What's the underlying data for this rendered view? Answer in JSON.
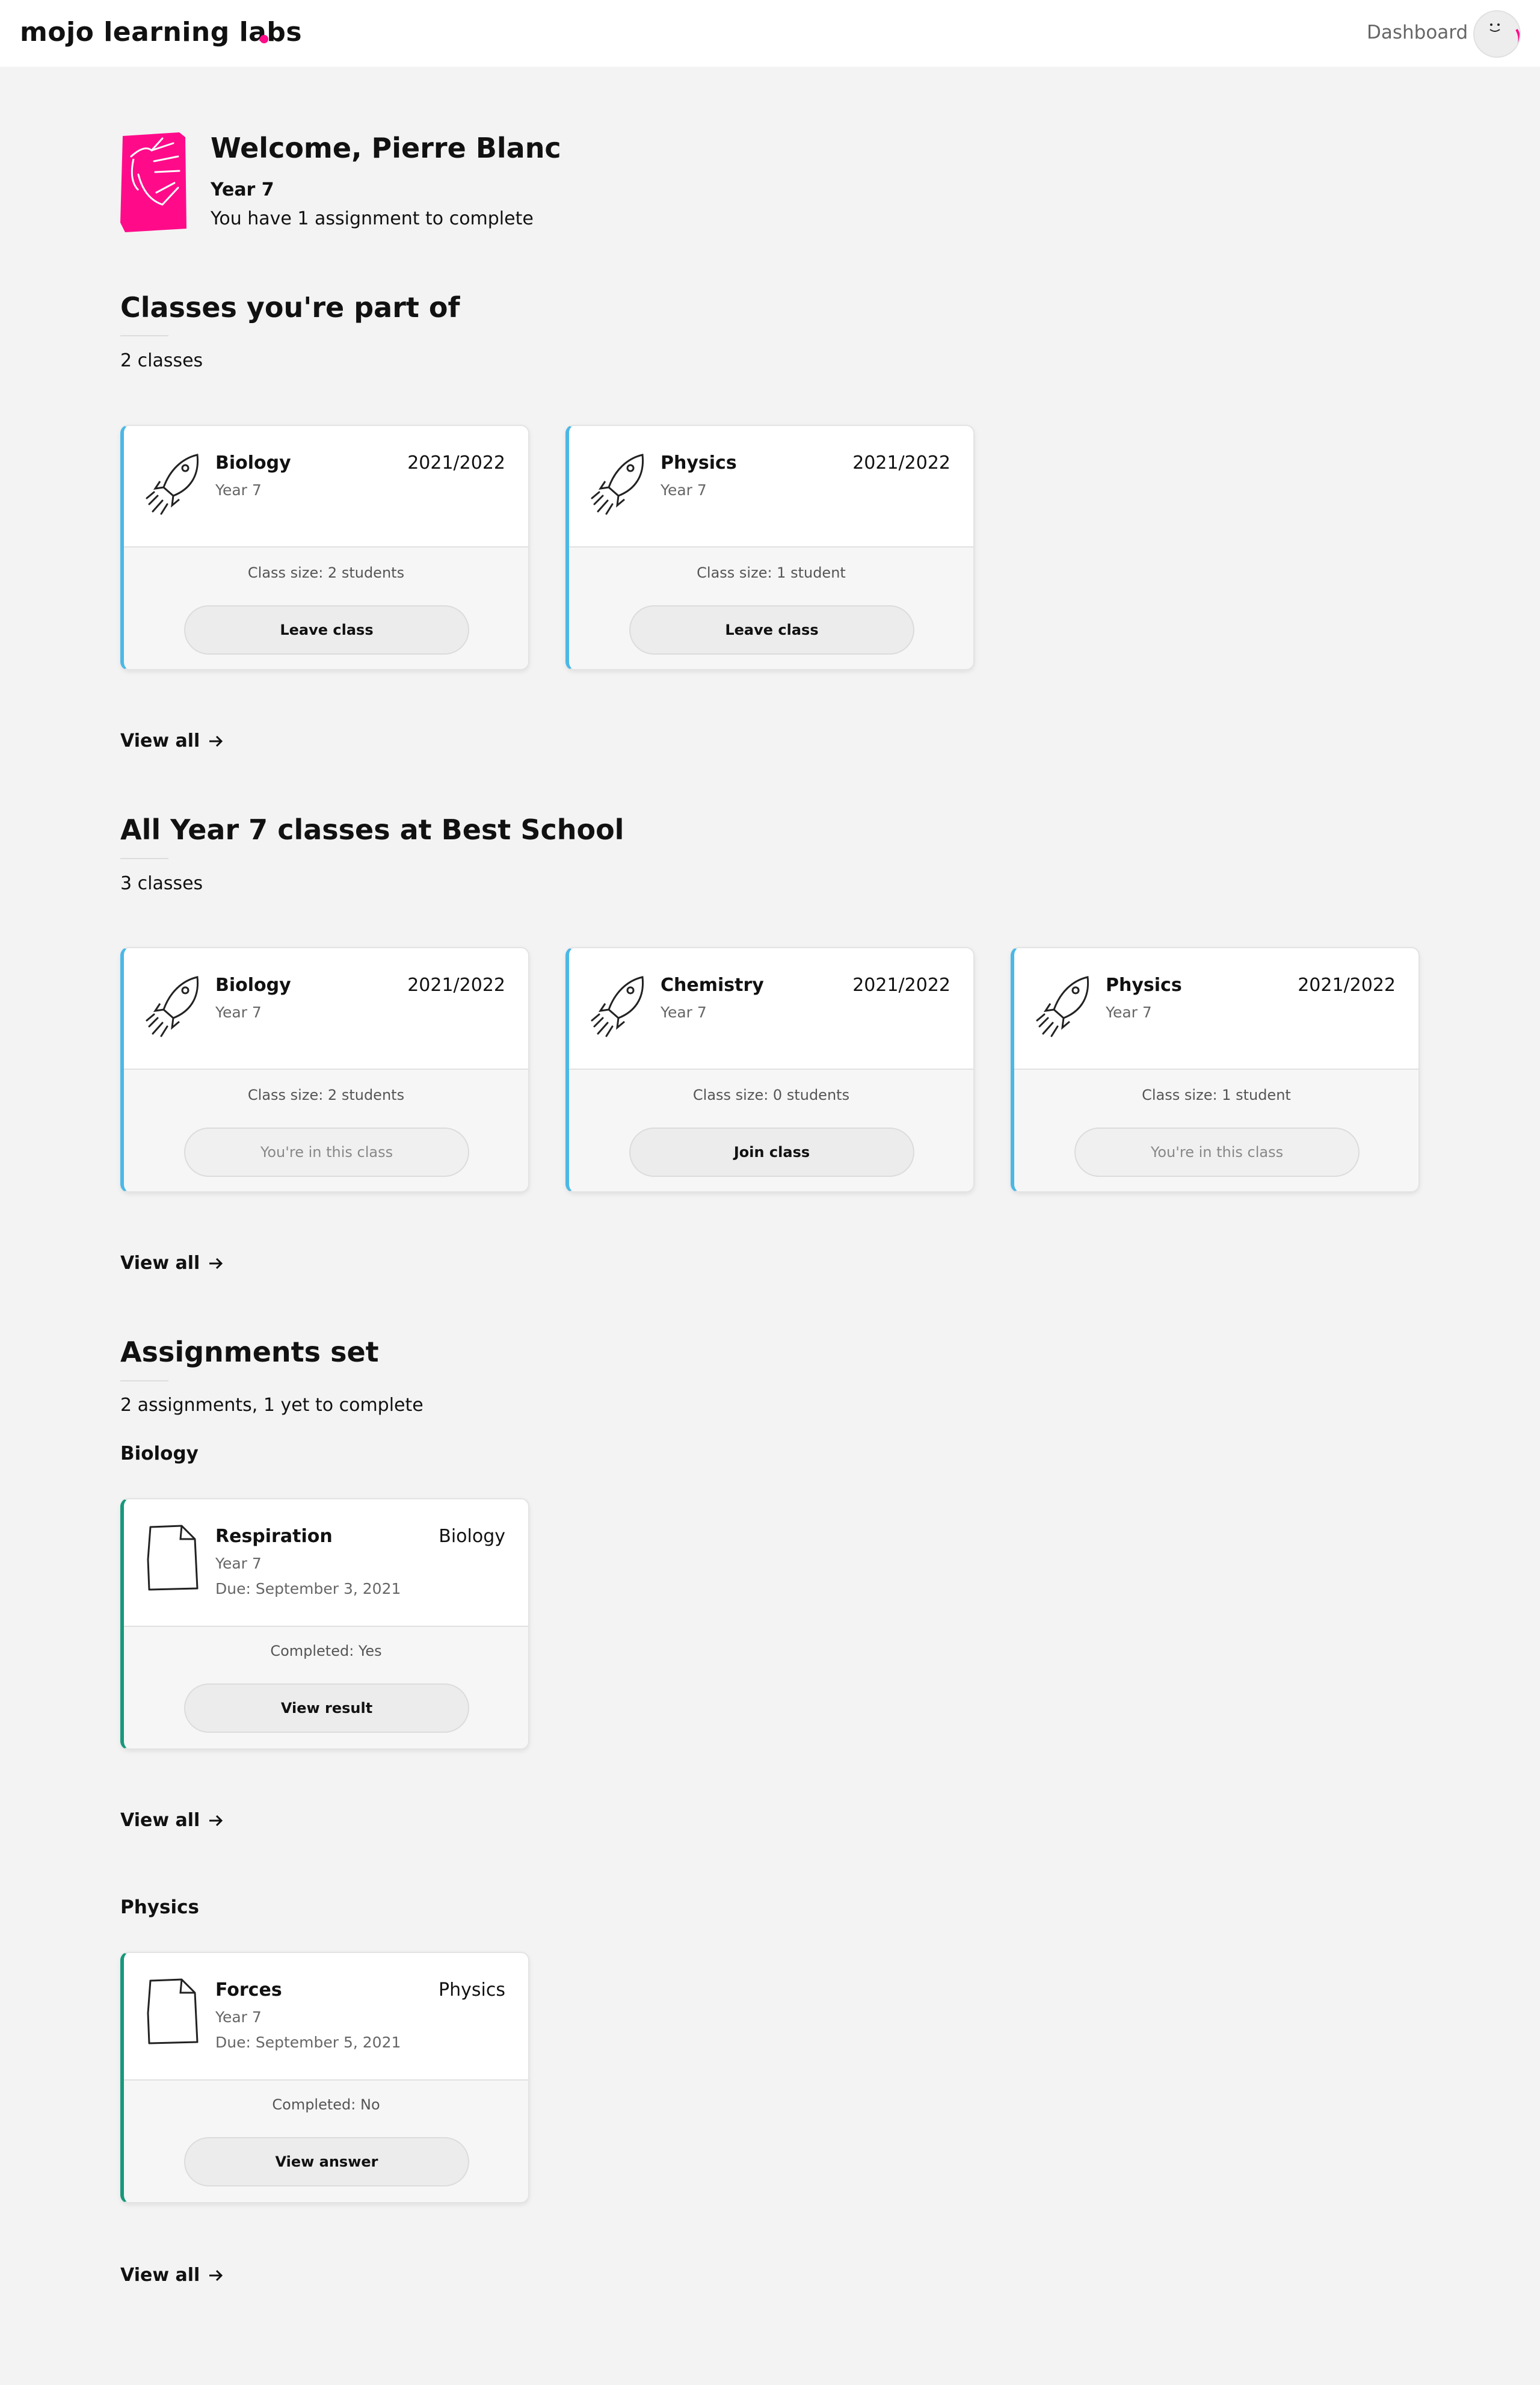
{
  "header": {
    "brand": "mojo learning labs",
    "nav_dashboard": "Dashboard",
    "accent_color": "#ff0b8a"
  },
  "welcome": {
    "title": "Welcome, Pierre Blanc",
    "year": "Year 7",
    "subtitle": "You have 1 assignment to complete"
  },
  "my_classes": {
    "title": "Classes you're part of",
    "count": "2 classes",
    "view_all": "View all",
    "cards": [
      {
        "name": "Biology",
        "year": "Year 7",
        "period": "2021/2022",
        "size": "Class size: 2 students",
        "button": "Leave class"
      },
      {
        "name": "Physics",
        "year": "Year 7",
        "period": "2021/2022",
        "size": "Class size: 1 student",
        "button": "Leave class"
      }
    ]
  },
  "all_classes": {
    "title": "All Year 7 classes at Best School",
    "count": "3 classes",
    "view_all": "View all",
    "cards": [
      {
        "name": "Biology",
        "year": "Year 7",
        "period": "2021/2022",
        "size": "Class size: 2 students",
        "button": "You're in this class"
      },
      {
        "name": "Chemistry",
        "year": "Year 7",
        "period": "2021/2022",
        "size": "Class size: 0 students",
        "button": "Join class"
      },
      {
        "name": "Physics",
        "year": "Year 7",
        "period": "2021/2022",
        "size": "Class size: 1 student",
        "button": "You're in this class"
      }
    ]
  },
  "assignments": {
    "title": "Assignments set",
    "count": "2 assignments, 1 yet to complete",
    "groups": [
      {
        "label": "Biology",
        "view_all": "View all",
        "card": {
          "name": "Respiration",
          "year": "Year 7",
          "due": "Due: September 3, 2021",
          "subject": "Biology",
          "completed": "Completed: Yes",
          "button": "View result"
        }
      },
      {
        "label": "Physics",
        "view_all": "View all",
        "card": {
          "name": "Forces",
          "year": "Year 7",
          "due": "Due: September 5, 2021",
          "subject": "Physics",
          "completed": "Completed: No",
          "button": "View answer"
        }
      }
    ]
  }
}
